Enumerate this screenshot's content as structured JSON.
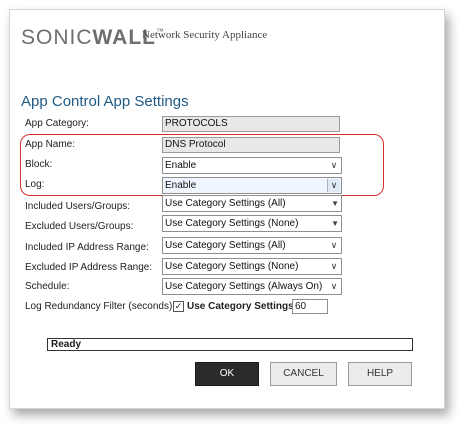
{
  "header": {
    "brand_prefix": "SONIC",
    "brand_suffix": "WALL",
    "brand_tm": "™",
    "subtitle": "Network Security Appliance"
  },
  "page": {
    "title": "App Control App Settings"
  },
  "fields": {
    "app_category": {
      "label": "App Category:",
      "value": "PROTOCOLS"
    },
    "app_name": {
      "label": "App Name:",
      "value": "DNS Protocol"
    },
    "block": {
      "label": "Block:",
      "value": "Enable"
    },
    "log": {
      "label": "Log:",
      "value": "Enable"
    },
    "included_users": {
      "label": "Included Users/Groups:",
      "value": "Use Category Settings (All)"
    },
    "excluded_users": {
      "label": "Excluded Users/Groups:",
      "value": "Use Category Settings (None)"
    },
    "included_ip": {
      "label": "Included IP Address Range:",
      "value": "Use Category Settings (All)"
    },
    "excluded_ip": {
      "label": "Excluded IP Address Range:",
      "value": "Use Category Settings (None)"
    },
    "schedule": {
      "label": "Schedule:",
      "value": "Use Category Settings (Always On)"
    },
    "log_redundancy": {
      "label": "Log Redundancy Filter (seconds):",
      "checkbox_label": "Use Category Settings",
      "checked": true,
      "value": "60"
    }
  },
  "status": {
    "text": "Ready"
  },
  "buttons": {
    "ok": "OK",
    "cancel": "CANCEL",
    "help": "HELP"
  },
  "colors": {
    "title": "#1f5a83",
    "highlight": "#d32f2f",
    "primary_button": "#2b2b2b"
  }
}
